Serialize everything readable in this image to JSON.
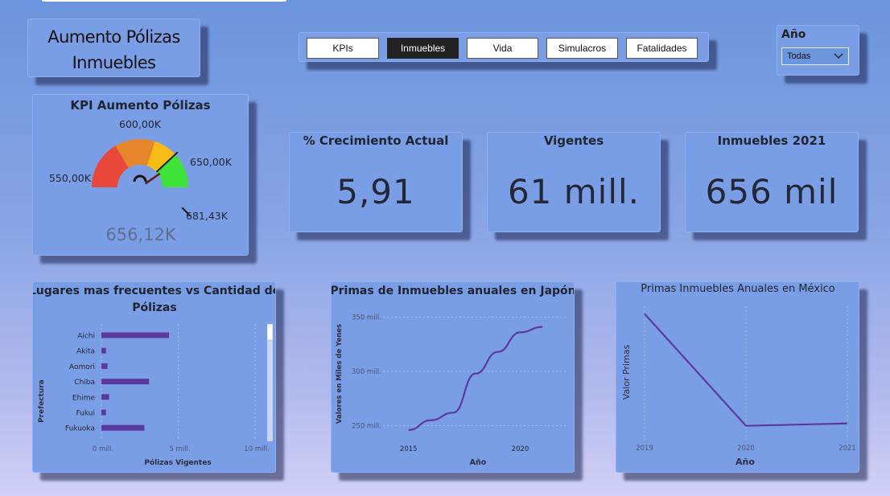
{
  "page_title": "Aumento Pólizas Inmuebles",
  "nav": {
    "buttons": [
      {
        "label": "KPIs",
        "active": false
      },
      {
        "label": "Inmuebles",
        "active": true
      },
      {
        "label": "Vida",
        "active": false
      },
      {
        "label": "Simulacros",
        "active": false
      },
      {
        "label": "Fatalidades",
        "active": false
      }
    ]
  },
  "year_filter": {
    "label": "Año",
    "selected": "Todas"
  },
  "gauge": {
    "title": "KPI Aumento Pólizas",
    "value_label": "656,12K",
    "value": 656120,
    "min": 550000,
    "max": 681430,
    "target": 650000,
    "labels": {
      "min": "550,00K",
      "mid": "600,00K",
      "target": "650,00K",
      "max": "681,43K"
    },
    "colors": [
      "#e8473a",
      "#e6862c",
      "#f7bc14",
      "#3ee337"
    ]
  },
  "kpis": [
    {
      "title": "% Crecimiento Actual",
      "value": "5,91"
    },
    {
      "title": "Vigentes",
      "value": "61 mill."
    },
    {
      "title": "Inmuebles 2021",
      "value": "656 mil"
    }
  ],
  "chart_data": [
    {
      "type": "bar",
      "title": "Lugares mas frecuentes vs Cantidad de Pólizas",
      "xlabel": "Pólizas Vigentes",
      "ylabel": "Prefectura",
      "categories": [
        "Aichi",
        "Akita",
        "Aomori",
        "Chiba",
        "Ehime",
        "Fukui",
        "Fukuoka"
      ],
      "values": [
        4.4,
        0.3,
        0.4,
        3.1,
        0.5,
        0.3,
        2.8
      ],
      "xlim": [
        0,
        10
      ],
      "xticks": [
        "0 mill.",
        "5 mill.",
        "10 mill."
      ],
      "color": "#5b3aa0"
    },
    {
      "type": "line",
      "title": "Primas de Inmuebles anuales en Japón",
      "xlabel": "Año",
      "ylabel": "Valores en Miles de Yenes",
      "x": [
        2015,
        2016,
        2017,
        2018,
        2019,
        2020,
        2021
      ],
      "values": [
        246,
        255,
        262,
        298,
        318,
        336,
        341
      ],
      "xlim": [
        2014,
        2022
      ],
      "ylim": [
        240,
        360
      ],
      "xticks": [
        "2015",
        "2020"
      ],
      "yticks": [
        "250 mill.",
        "300 mill.",
        "350 mill."
      ],
      "color": "#5b3aa0"
    },
    {
      "type": "line",
      "title": "Primas Inmuebles Anuales en México",
      "xlabel": "Año",
      "ylabel": "Valor Primas",
      "x": [
        "2019",
        "2020",
        "2021"
      ],
      "values": [
        100,
        5,
        7
      ],
      "ylim": [
        0,
        105
      ],
      "color": "#5b3aa0"
    }
  ]
}
